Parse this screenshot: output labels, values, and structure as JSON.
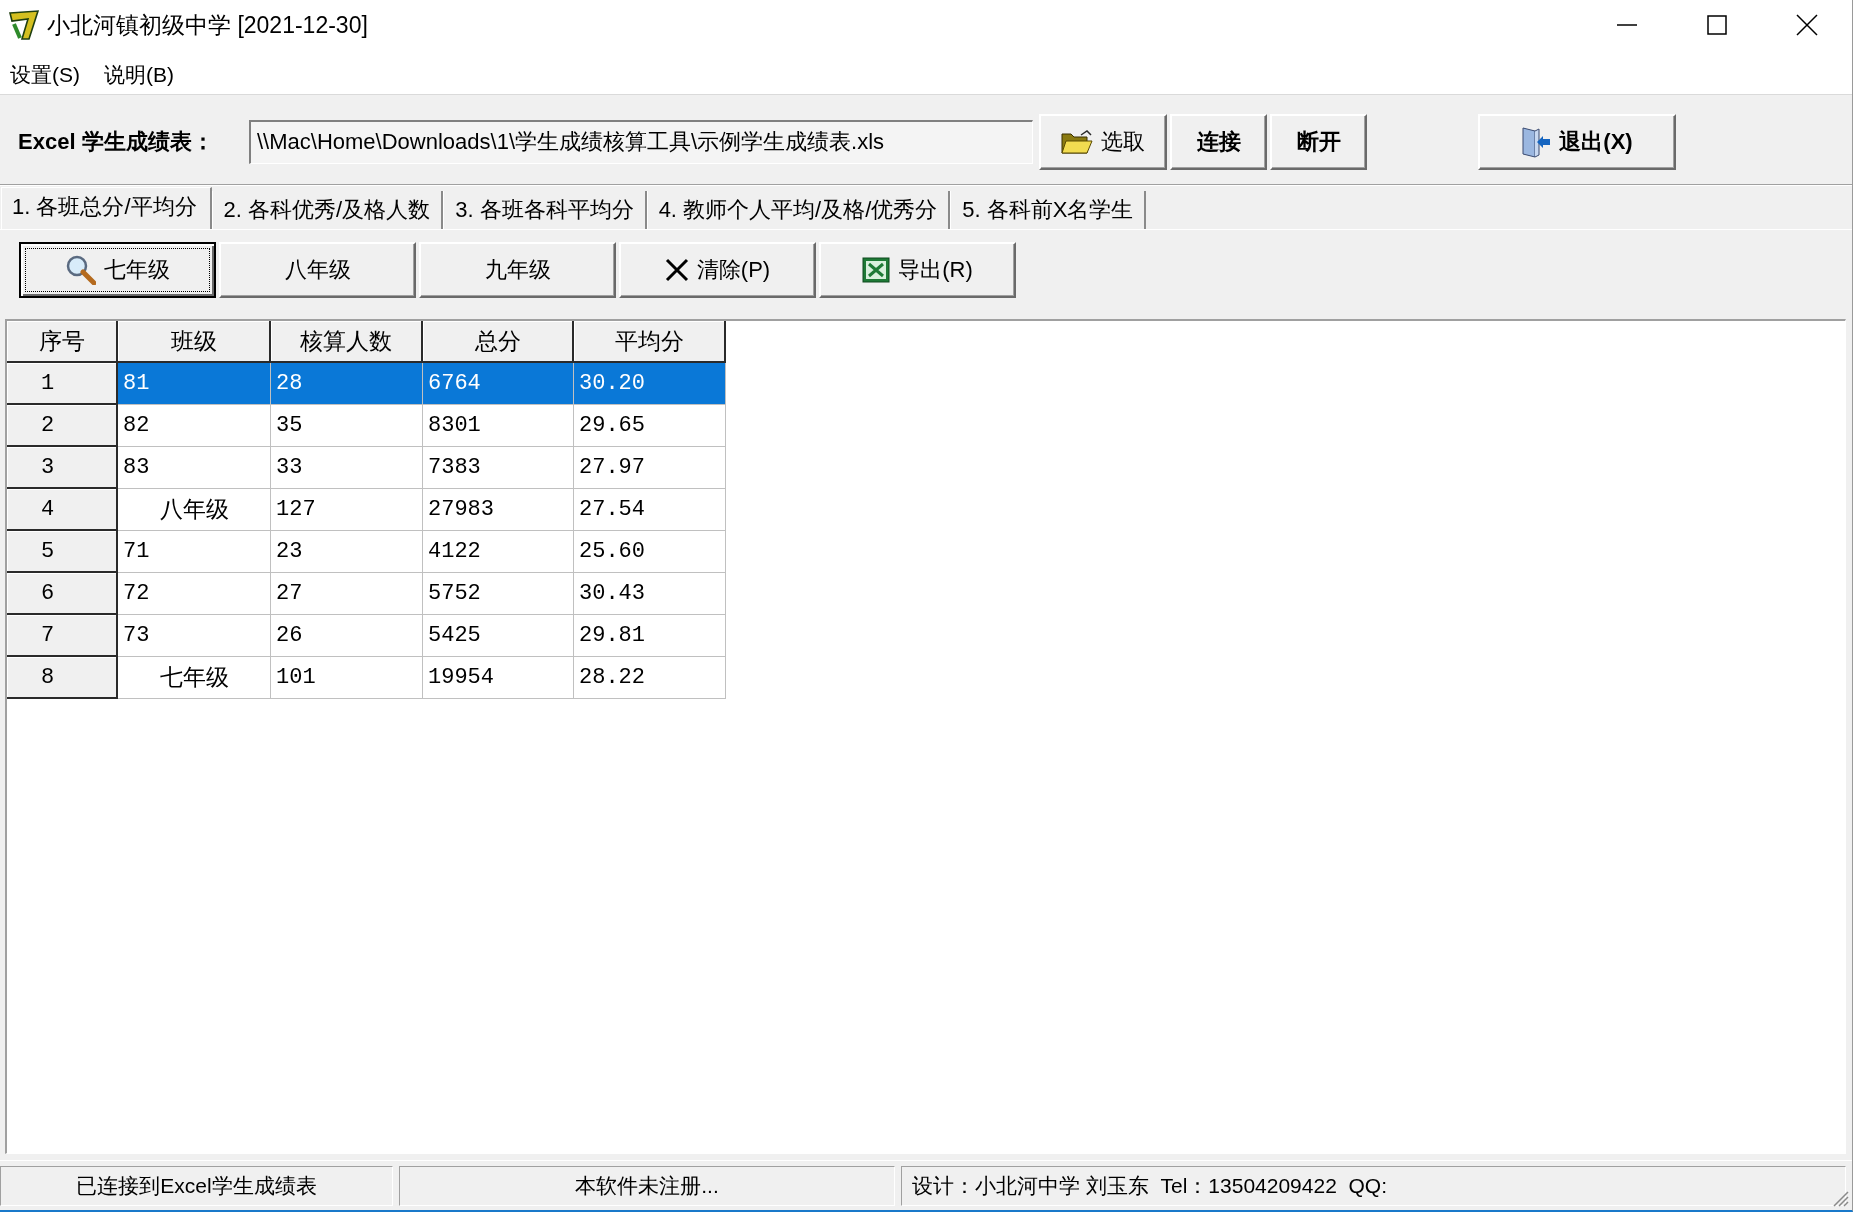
{
  "window": {
    "title": "小北河镇初级中学 [2021-12-30]"
  },
  "menu": [
    {
      "label": "设置(S)"
    },
    {
      "label": "说明(B)"
    }
  ],
  "toolbar": {
    "label": "Excel 学生成绩表：",
    "path_field": {
      "value": "\\\\Mac\\Home\\Downloads\\1\\学生成绩核算工具\\示例学生成绩表.xls"
    },
    "buttons": [
      {
        "label": "选取",
        "kind": "open",
        "bold": false
      },
      {
        "label": "连接",
        "kind": "plain",
        "bold": true
      },
      {
        "label": "断开",
        "kind": "plain",
        "bold": true
      },
      {
        "label": "退出(X)",
        "kind": "exit",
        "bold": true
      }
    ]
  },
  "tabs": [
    {
      "label": "1. 各班总分/平均分",
      "selected": true
    },
    {
      "label": "2. 各科优秀/及格人数",
      "selected": false
    },
    {
      "label": "3. 各班各科平均分",
      "selected": false
    },
    {
      "label": "4. 教师个人平均/及格/优秀分",
      "selected": false
    },
    {
      "label": "5. 各科前X名学生",
      "selected": false
    }
  ],
  "grade_buttons": [
    {
      "label": "七年级",
      "kind": "search",
      "focused": true
    },
    {
      "label": "八年级",
      "kind": "grade",
      "focused": false
    },
    {
      "label": "九年级",
      "kind": "grade",
      "focused": false
    },
    {
      "label": "清除(P)",
      "kind": "clear",
      "focused": false
    },
    {
      "label": "导出(R)",
      "kind": "export",
      "focused": false
    }
  ],
  "table": {
    "columns": [
      "序号",
      "班级",
      "核算人数",
      "总分",
      "平均分"
    ],
    "rows": [
      {
        "cells": [
          "1",
          "81",
          "28",
          "6764",
          "30.20"
        ],
        "kind": "class",
        "selected": true
      },
      {
        "cells": [
          "2",
          "82",
          "35",
          "8301",
          "29.65"
        ],
        "kind": "class",
        "selected": false
      },
      {
        "cells": [
          "3",
          "83",
          "33",
          "7383",
          "27.97"
        ],
        "kind": "class",
        "selected": false
      },
      {
        "cells": [
          "4",
          "八年级",
          "127",
          "27983",
          "27.54"
        ],
        "kind": "total",
        "selected": false
      },
      {
        "cells": [
          "5",
          "71",
          "23",
          "4122",
          "25.60"
        ],
        "kind": "class",
        "selected": false
      },
      {
        "cells": [
          "6",
          "72",
          "27",
          "5752",
          "30.43"
        ],
        "kind": "class",
        "selected": false
      },
      {
        "cells": [
          "7",
          "73",
          "26",
          "5425",
          "29.81"
        ],
        "kind": "class",
        "selected": false
      },
      {
        "cells": [
          "8",
          "七年级",
          "101",
          "19954",
          "28.22"
        ],
        "kind": "total",
        "selected": false
      }
    ]
  },
  "status_bar": [
    "已连接到Excel学生成绩表",
    "本软件未注册...",
    "设计：小北河中学 刘玉东  Tel：13504209422  QQ:"
  ]
}
